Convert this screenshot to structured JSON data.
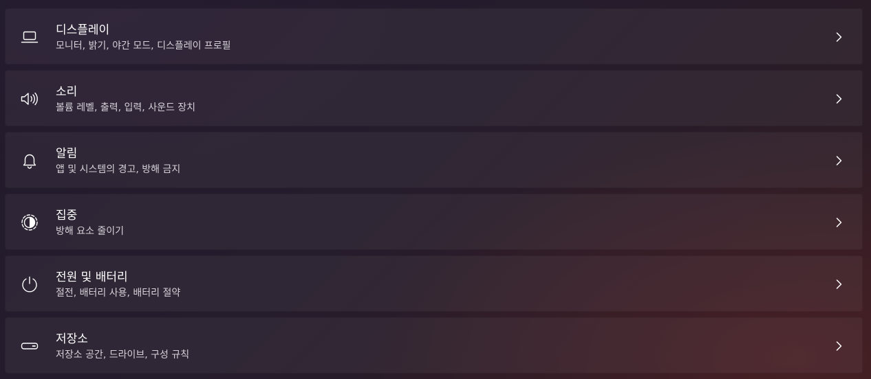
{
  "settings_list": {
    "items": [
      {
        "title": "디스플레이",
        "subtitle": "모니터, 밝기, 야간 모드, 디스플레이 프로필",
        "icon": "laptop-icon"
      },
      {
        "title": "소리",
        "subtitle": "볼륨 레벨, 출력, 입력, 사운드 장치",
        "icon": "speaker-icon"
      },
      {
        "title": "알림",
        "subtitle": "앱 및 시스템의 경고, 방해 금지",
        "icon": "bell-icon"
      },
      {
        "title": "집중",
        "subtitle": "방해 요소 줄이기",
        "icon": "focus-icon"
      },
      {
        "title": "전원 및 배터리",
        "subtitle": "절전, 배터리 사용, 배터리 절약",
        "icon": "power-icon"
      },
      {
        "title": "저장소",
        "subtitle": "저장소 공간, 드라이브, 구성 규칙",
        "icon": "drive-icon"
      }
    ]
  },
  "colors": {
    "text_primary": "#ffffff",
    "text_secondary": "#d6d1d8",
    "card_background": "rgba(255,255,255,0.052)"
  }
}
